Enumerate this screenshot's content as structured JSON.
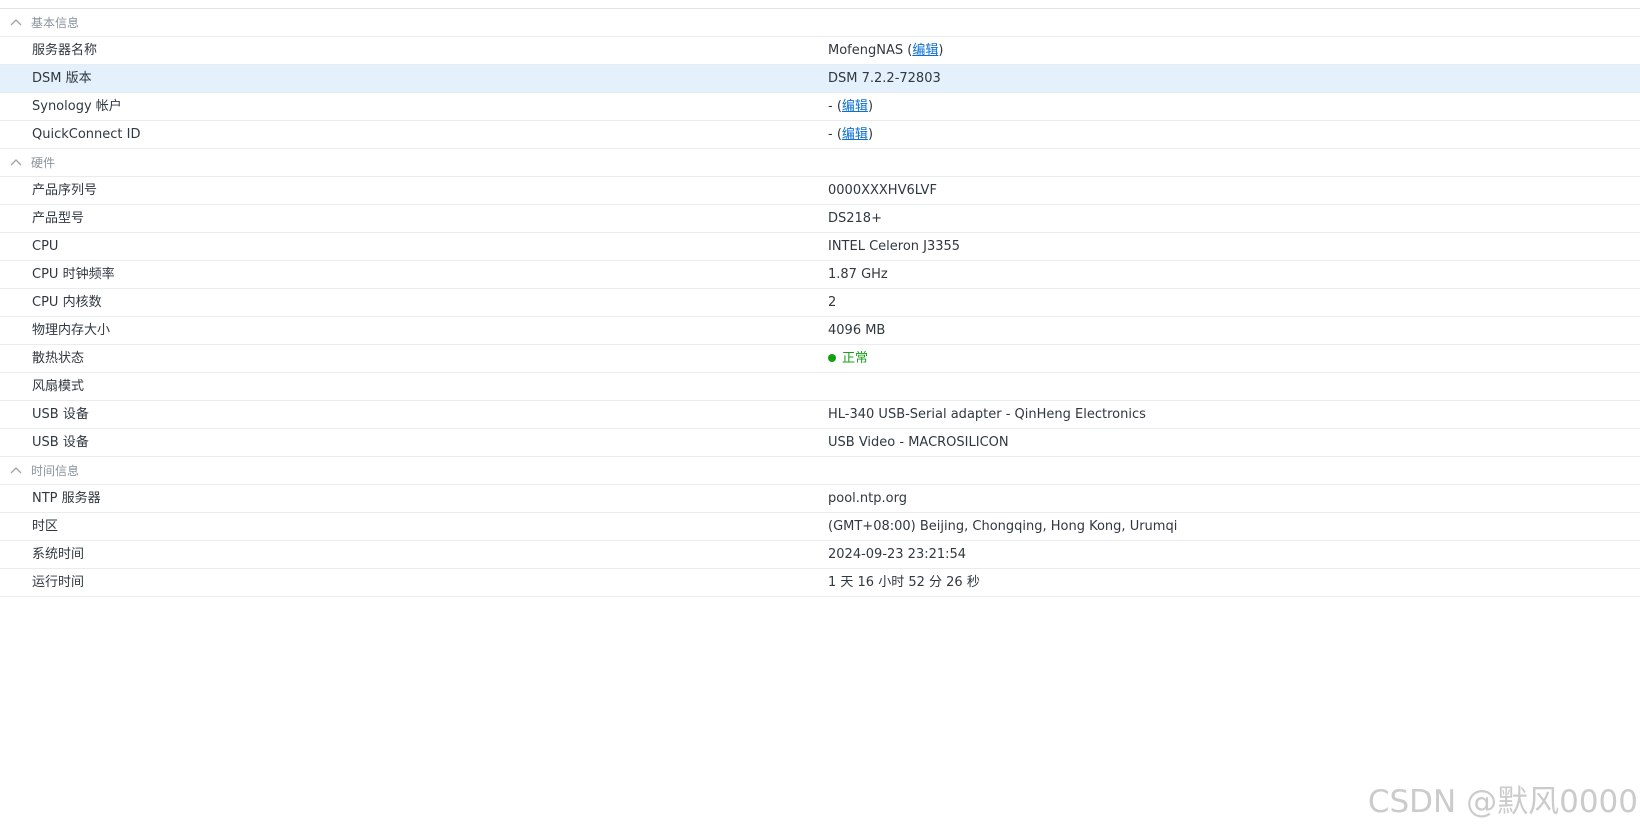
{
  "sections": [
    {
      "title": "基本信息",
      "rows": [
        {
          "label": "服务器名称",
          "value": "MofengNAS",
          "edit": "编辑"
        },
        {
          "label": "DSM 版本",
          "value": "DSM 7.2.2-72803"
        },
        {
          "label": "Synology 帐户",
          "value": "-",
          "edit": "编辑"
        },
        {
          "label": "QuickConnect ID",
          "value": "-",
          "edit": "编辑"
        }
      ]
    },
    {
      "title": "硬件",
      "rows": [
        {
          "label": "产品序列号",
          "value": "0000XXXHV6LVF"
        },
        {
          "label": "产品型号",
          "value": "DS218+"
        },
        {
          "label": "CPU",
          "value": "INTEL Celeron J3355"
        },
        {
          "label": "CPU 时钟频率",
          "value": "1.87 GHz"
        },
        {
          "label": "CPU 内核数",
          "value": "2"
        },
        {
          "label": "物理内存大小",
          "value": "4096 MB"
        },
        {
          "label": "散热状态",
          "value": "正常"
        },
        {
          "label": "风扇模式",
          "value": ""
        },
        {
          "label": "USB 设备",
          "value": "HL-340 USB-Serial adapter - QinHeng Electronics"
        },
        {
          "label": "USB 设备",
          "value": "USB Video - MACROSILICON"
        }
      ]
    },
    {
      "title": "时间信息",
      "rows": [
        {
          "label": "NTP 服务器",
          "value": "pool.ntp.org"
        },
        {
          "label": "时区",
          "value": "(GMT+08:00) Beijing, Chongqing, Hong Kong, Urumqi"
        },
        {
          "label": "系统时间",
          "value": "2024-09-23 23:21:54"
        },
        {
          "label": "运行时间",
          "value": "1 天 16 小时 52 分 26 秒"
        }
      ]
    }
  ],
  "watermark": "CSDN @默风0000",
  "colors": {
    "highlight_row": "#e4f0fb",
    "link": "#0a6fd6",
    "status_ok": "#18a018",
    "section_text": "#8a939c"
  },
  "icons": {
    "section_toggle": "chevron-up-icon",
    "thermal_status": "status-dot-icon"
  }
}
